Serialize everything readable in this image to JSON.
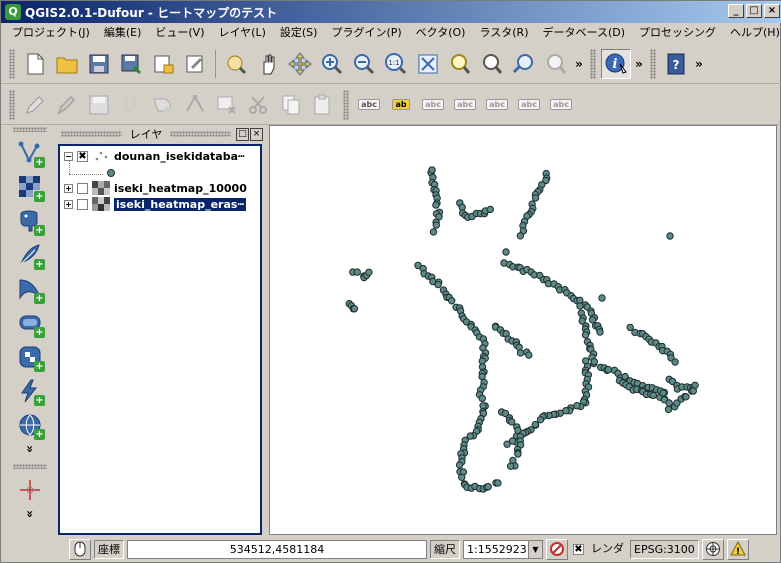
{
  "window": {
    "title": "QGIS2.0.1-Dufour - ヒートマップのテスト",
    "app_icon": "Q",
    "controls": [
      "_",
      "□",
      "×"
    ]
  },
  "menu": [
    "プロジェクト(J)",
    "編集(E)",
    "ビュー(V)",
    "レイヤ(L)",
    "設定(S)",
    "プラグイン(P)",
    "ベクタ(O)",
    "ラスタ(R)",
    "データベース(D)",
    "プロセッシング",
    "ヘルプ(H)"
  ],
  "toolbar": {
    "more": "»",
    "help_glyph": "?"
  },
  "toolbar2": {
    "label_glyph": "abc",
    "label_glyph_ab": "ab"
  },
  "left_tools": {
    "more": "»"
  },
  "layers_panel": {
    "title": "レイヤ",
    "float_glyph": "□",
    "close_glyph": "×",
    "layers": [
      {
        "name": "dounan_isekidataba┅",
        "checked": true,
        "expander": "−"
      },
      {
        "name": "iseki_heatmap_10000",
        "checked": false,
        "expander": "+"
      },
      {
        "name": "iseki_heatmap_eras┅",
        "checked": false,
        "expander": "+",
        "selected": true
      }
    ],
    "check_glyph": "✖"
  },
  "map": {
    "point_fill": "#5e8a88",
    "point_stroke": "#1e2e2e"
  },
  "statusbar": {
    "coord_label": "座標",
    "coord_value": "534512,4581184",
    "scale_label": "縮尺",
    "scale_value": "1:1552923",
    "combo_arrow": "▼",
    "render_label": "レンダ",
    "render_check": "✖",
    "crs": "EPSG:3100",
    "warning_glyph": "!"
  }
}
